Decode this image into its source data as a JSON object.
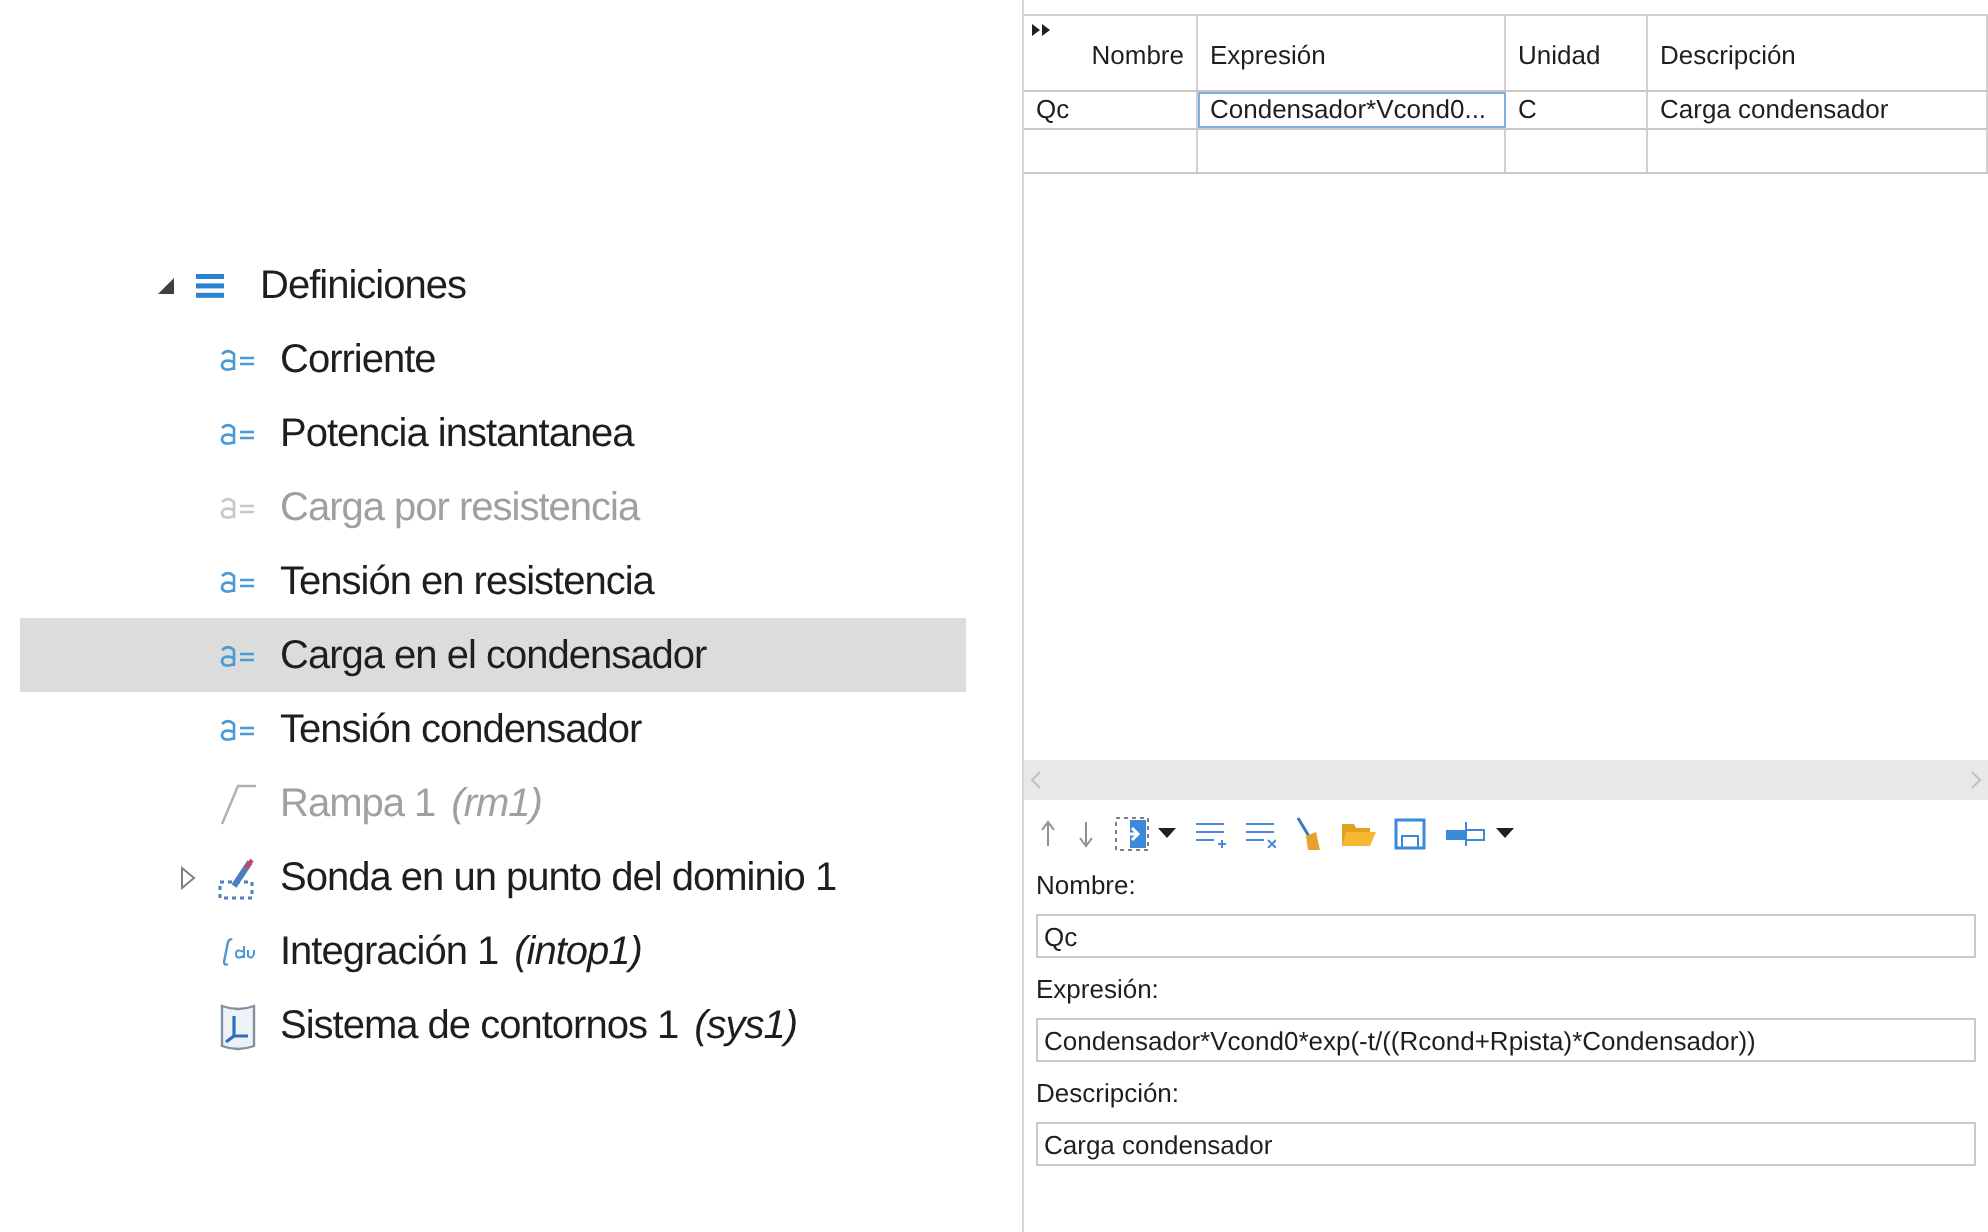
{
  "tree": {
    "label": "Definiciones",
    "expanded": true,
    "children": [
      {
        "kind": "variable",
        "label": "Corriente",
        "disabled": false,
        "selected": false
      },
      {
        "kind": "variable",
        "label": "Potencia instantanea",
        "disabled": false,
        "selected": false
      },
      {
        "kind": "variable",
        "label": "Carga por resistencia",
        "disabled": true,
        "selected": false
      },
      {
        "kind": "variable",
        "label": "Tensión en resistencia",
        "disabled": false,
        "selected": false
      },
      {
        "kind": "variable",
        "label": "Carga en el condensador",
        "disabled": false,
        "selected": true
      },
      {
        "kind": "variable",
        "label": "Tensión condensador",
        "disabled": false,
        "selected": false
      },
      {
        "kind": "ramp",
        "label": "Rampa 1",
        "tag": "(rm1)",
        "disabled": true,
        "selected": false
      },
      {
        "kind": "probe",
        "label": "Sonda en un punto del dominio 1",
        "disabled": false,
        "selected": false,
        "expanded": false
      },
      {
        "kind": "integration",
        "label": "Integración 1",
        "tag": "(intop1)",
        "disabled": false,
        "selected": false
      },
      {
        "kind": "system",
        "label": "Sistema de contornos 1",
        "tag": "(sys1)",
        "disabled": false,
        "selected": false
      }
    ]
  },
  "table": {
    "columns": [
      "Nombre",
      "Expresión",
      "Unidad",
      "Descripción"
    ],
    "rows": [
      [
        "Qc",
        "Condensador*Vcond0...",
        "C",
        "Carga condensador"
      ]
    ]
  },
  "form": [
    {
      "label": "Nombre:",
      "value": "Qc"
    },
    {
      "label": "Expresión:",
      "value": "Condensador*Vcond0*exp(-t/((Rcond+Rpista)*Condensador))"
    },
    {
      "label": "Descripción:",
      "value": "Carga condensador"
    }
  ]
}
